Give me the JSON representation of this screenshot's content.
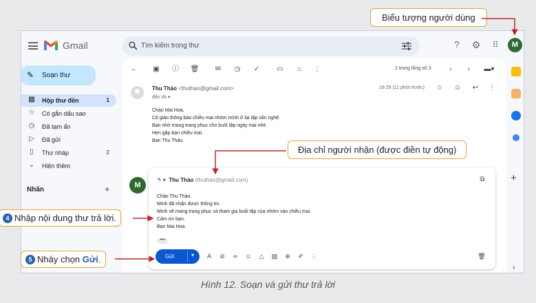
{
  "app": {
    "name": "Gmail"
  },
  "search": {
    "placeholder": "Tìm kiếm trong thư"
  },
  "user": {
    "initial": "M"
  },
  "sidebar": {
    "compose_label": "Soạn thư",
    "items": [
      {
        "label": "Hộp thư đến",
        "count": "1",
        "icon": "inbox-icon"
      },
      {
        "label": "Có gắn dấu sao",
        "count": "",
        "icon": "star-icon"
      },
      {
        "label": "Đã tạm ẩn",
        "count": "",
        "icon": "clock-icon"
      },
      {
        "label": "Đã gửi",
        "count": "",
        "icon": "send-icon"
      },
      {
        "label": "Thư nháp",
        "count": "2",
        "icon": "draft-icon"
      },
      {
        "label": "Hiện thêm",
        "count": "",
        "icon": "chevron-down-icon"
      }
    ],
    "labels_heading": "Nhãn"
  },
  "toolbar": {
    "pager": "2 trong tổng số 3"
  },
  "message": {
    "sender_name": "Thu Thảo",
    "sender_email": "<thuthao@gmail.com>",
    "to": "đến tôi ▾",
    "time": "18:26 (11 phút trước)",
    "body": [
      "Chào Mai Hoa,",
      "Cô giáo thông báo chiều mai nhóm mình ở lại tập văn nghệ.",
      "Bạn nhớ mang trang phục cho buổi tập ngày mai nhé.",
      "Hẹn gặp bạn chiều mai.",
      "Bạn Thu Thảo."
    ]
  },
  "reply": {
    "to_name": "Thu Thảo",
    "to_email": "(thuthao@gmail.com)",
    "body": [
      "Chào Thu Thảo,",
      "Mình đã nhận được thông tin.",
      "Mình sẽ mang trang phục và tham gia buổi tập của nhóm vào chiều mai.",
      "Cảm ơn bạn.",
      "Bạn Mai Hoa."
    ],
    "ellipsis": "•••",
    "send_label": "Gửi"
  },
  "callouts": {
    "user_icon": "Biểu tượng người dùng",
    "recipient": "Địa chỉ người nhận (được điền tự động)",
    "step4_num": "4",
    "step4_text": "Nhập nội dung thư trả lời.",
    "step5_num": "5",
    "step5_pre": "Nháy chọn ",
    "step5_bold": "Gửi",
    "step5_post": "."
  },
  "caption": "Hình 12. Soạn và gửi thư trả lời",
  "colors": {
    "accent": "#0b57d0",
    "callout_border": "#e3a33a",
    "arrow": "#c0232b",
    "avatar": "#2d6a2f"
  }
}
